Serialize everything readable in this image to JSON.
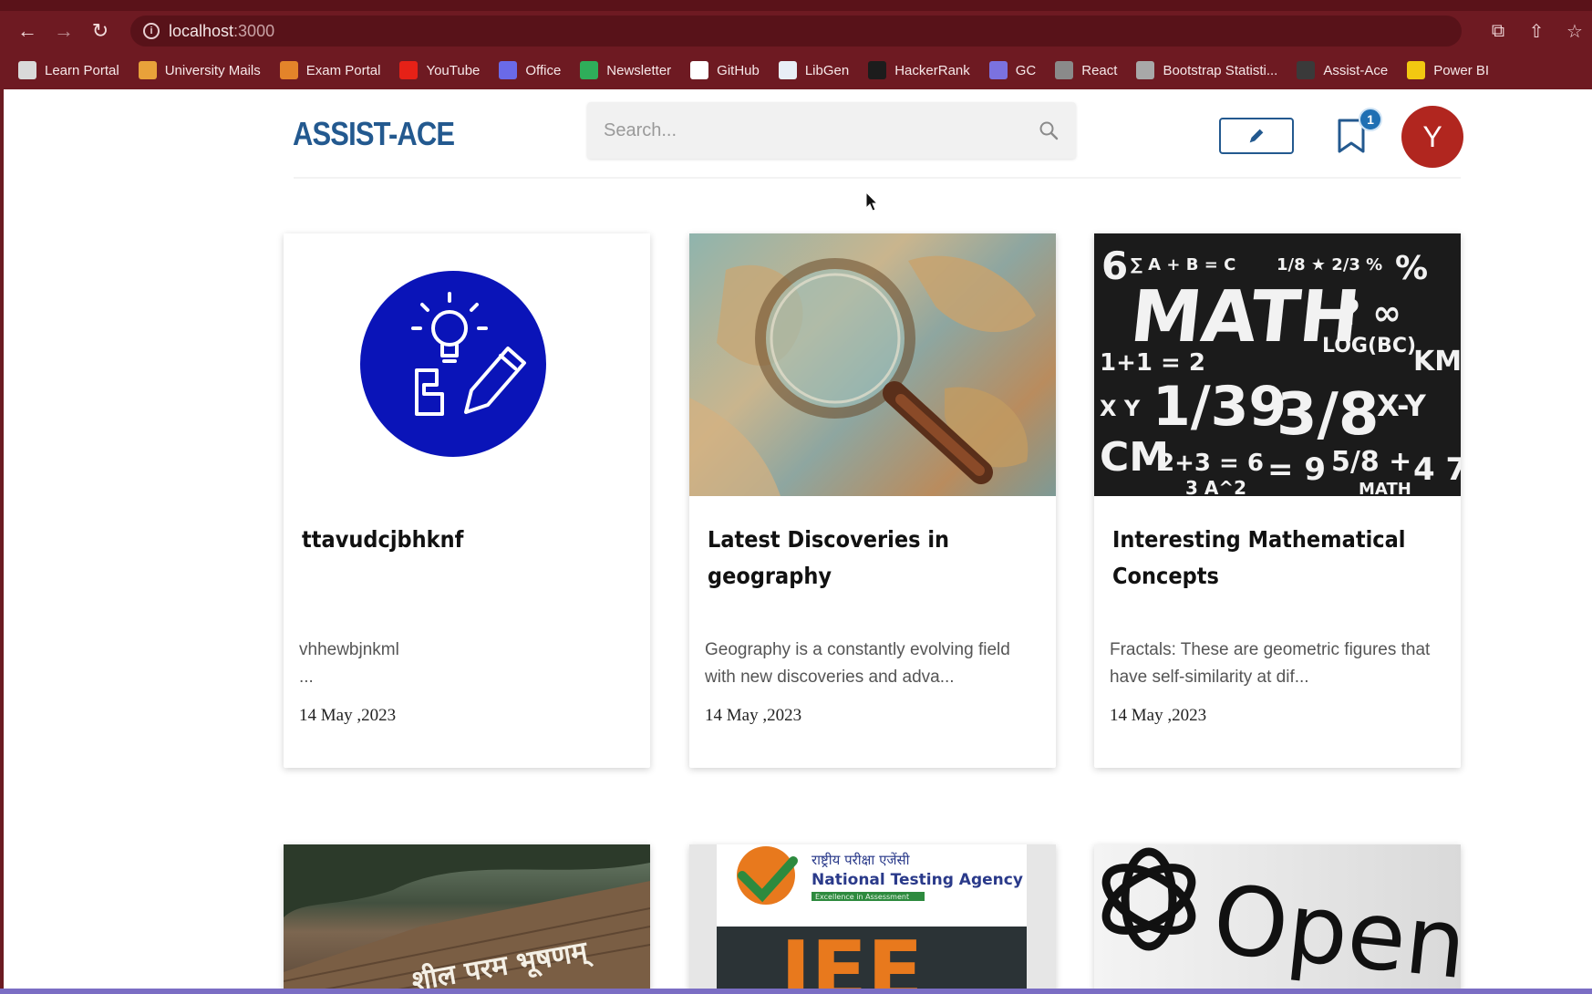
{
  "browser": {
    "url_host": "localhost",
    "url_port": ":3000",
    "bookmarks": [
      {
        "label": "Learn Portal",
        "color": "#d9d9d9"
      },
      {
        "label": "University Mails",
        "color": "#e8a13a"
      },
      {
        "label": "Exam Portal",
        "color": "#e3842a"
      },
      {
        "label": "YouTube",
        "color": "#e62117"
      },
      {
        "label": "Office",
        "color": "#6a6ae8"
      },
      {
        "label": "Newsletter",
        "color": "#2fae5a"
      },
      {
        "label": "GitHub",
        "color": "#ffffff"
      },
      {
        "label": "LibGen",
        "color": "#e8eef6"
      },
      {
        "label": "HackerRank",
        "color": "#1c1c1c"
      },
      {
        "label": "GC",
        "color": "#7b72e0"
      },
      {
        "label": "React",
        "color": "#8a8a8a"
      },
      {
        "label": "Bootstrap Statisti...",
        "color": "#a8a8a8"
      },
      {
        "label": "Assist-Ace",
        "color": "#3a3a3a"
      },
      {
        "label": "Power BI",
        "color": "#f2c811"
      }
    ]
  },
  "header": {
    "logo": "ASSIST-ACE",
    "search_placeholder": "Search...",
    "bookmark_count": "1",
    "avatar_initial": "Y",
    "accent": "#23598f"
  },
  "cards": [
    {
      "title": "ttavudcjbhknf",
      "desc": "vhhewbjnkml\n...",
      "date": "14 May ,2023",
      "image": "blog-logo-icon"
    },
    {
      "title": "Latest Discoveries in geography",
      "desc": "Geography is a constantly evolving field with new discoveries and adva...",
      "date": "14 May ,2023",
      "image": "map-magnifier-photo"
    },
    {
      "title": "Interesting Mathematical Concepts",
      "desc": "Fractals: These are geometric figures that have self-similarity at dif...",
      "date": "14 May ,2023",
      "image": "math-chalkboard-photo"
    }
  ],
  "bottom_cards": [
    {
      "image": "campus-wall-photo",
      "text": "शील परम भूषणम्"
    },
    {
      "image": "nta-logo-photo",
      "text_hi": "राष्ट्रीय परीक्षा एजेंसी",
      "text_en": "National Testing Agency",
      "tagline": "Excellence in Assessment",
      "big": "JEE"
    },
    {
      "image": "openai-logo-photo",
      "text": "OpenAI"
    }
  ]
}
